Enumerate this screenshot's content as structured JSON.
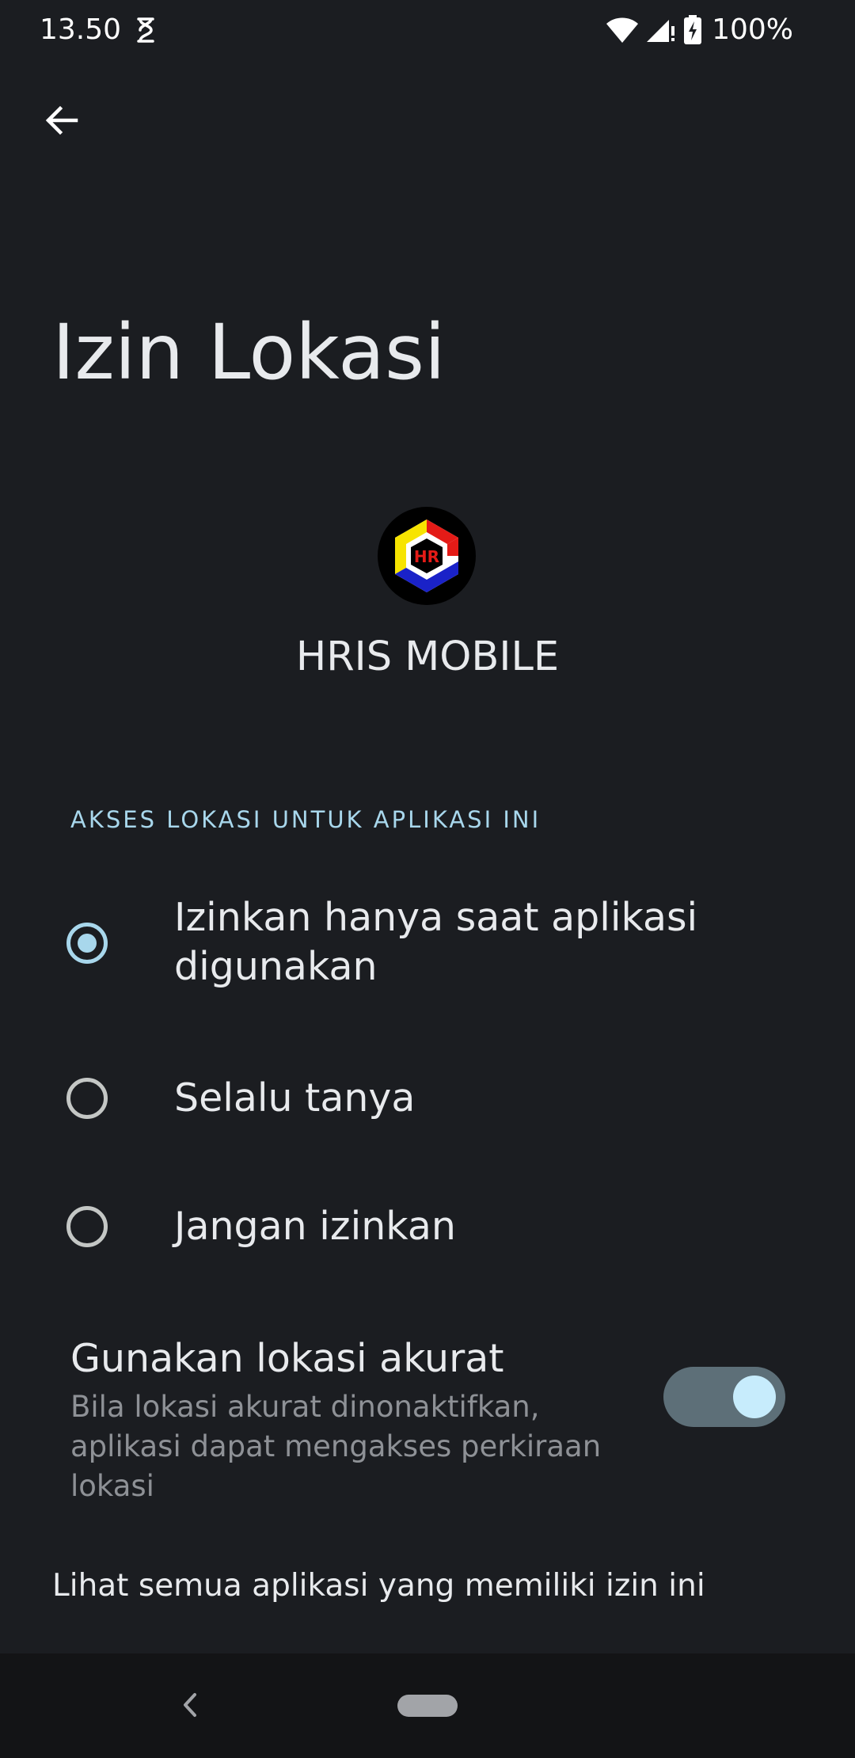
{
  "status_bar": {
    "time": "13.50",
    "battery": "100%",
    "icons": [
      "dnd-icon",
      "wifi-icon",
      "cell-signal-icon",
      "battery-charging-icon"
    ]
  },
  "header": {
    "back_icon": "arrow-left-icon",
    "title": "Izin Lokasi"
  },
  "app": {
    "name": "HRIS MOBILE",
    "icon": "hris-logo",
    "logo_text": "HR"
  },
  "section": {
    "title": "AKSES LOKASI UNTUK APLIKASI INI"
  },
  "options": [
    {
      "label": "Izinkan hanya saat aplikasi digunakan",
      "checked": true
    },
    {
      "label": "Selalu tanya",
      "checked": false
    },
    {
      "label": "Jangan izinkan",
      "checked": false
    }
  ],
  "precise_location": {
    "title": "Gunakan lokasi akurat",
    "summary": "Bila lokasi akurat dinonaktifkan, aplikasi dapat mengakses perkiraan lokasi",
    "enabled": true
  },
  "link": {
    "label": "Lihat semua aplikasi yang memiliki izin ini"
  },
  "colors": {
    "background": "#1b1d21",
    "accent": "#a8d7ec",
    "nav_bar": "#131416"
  }
}
